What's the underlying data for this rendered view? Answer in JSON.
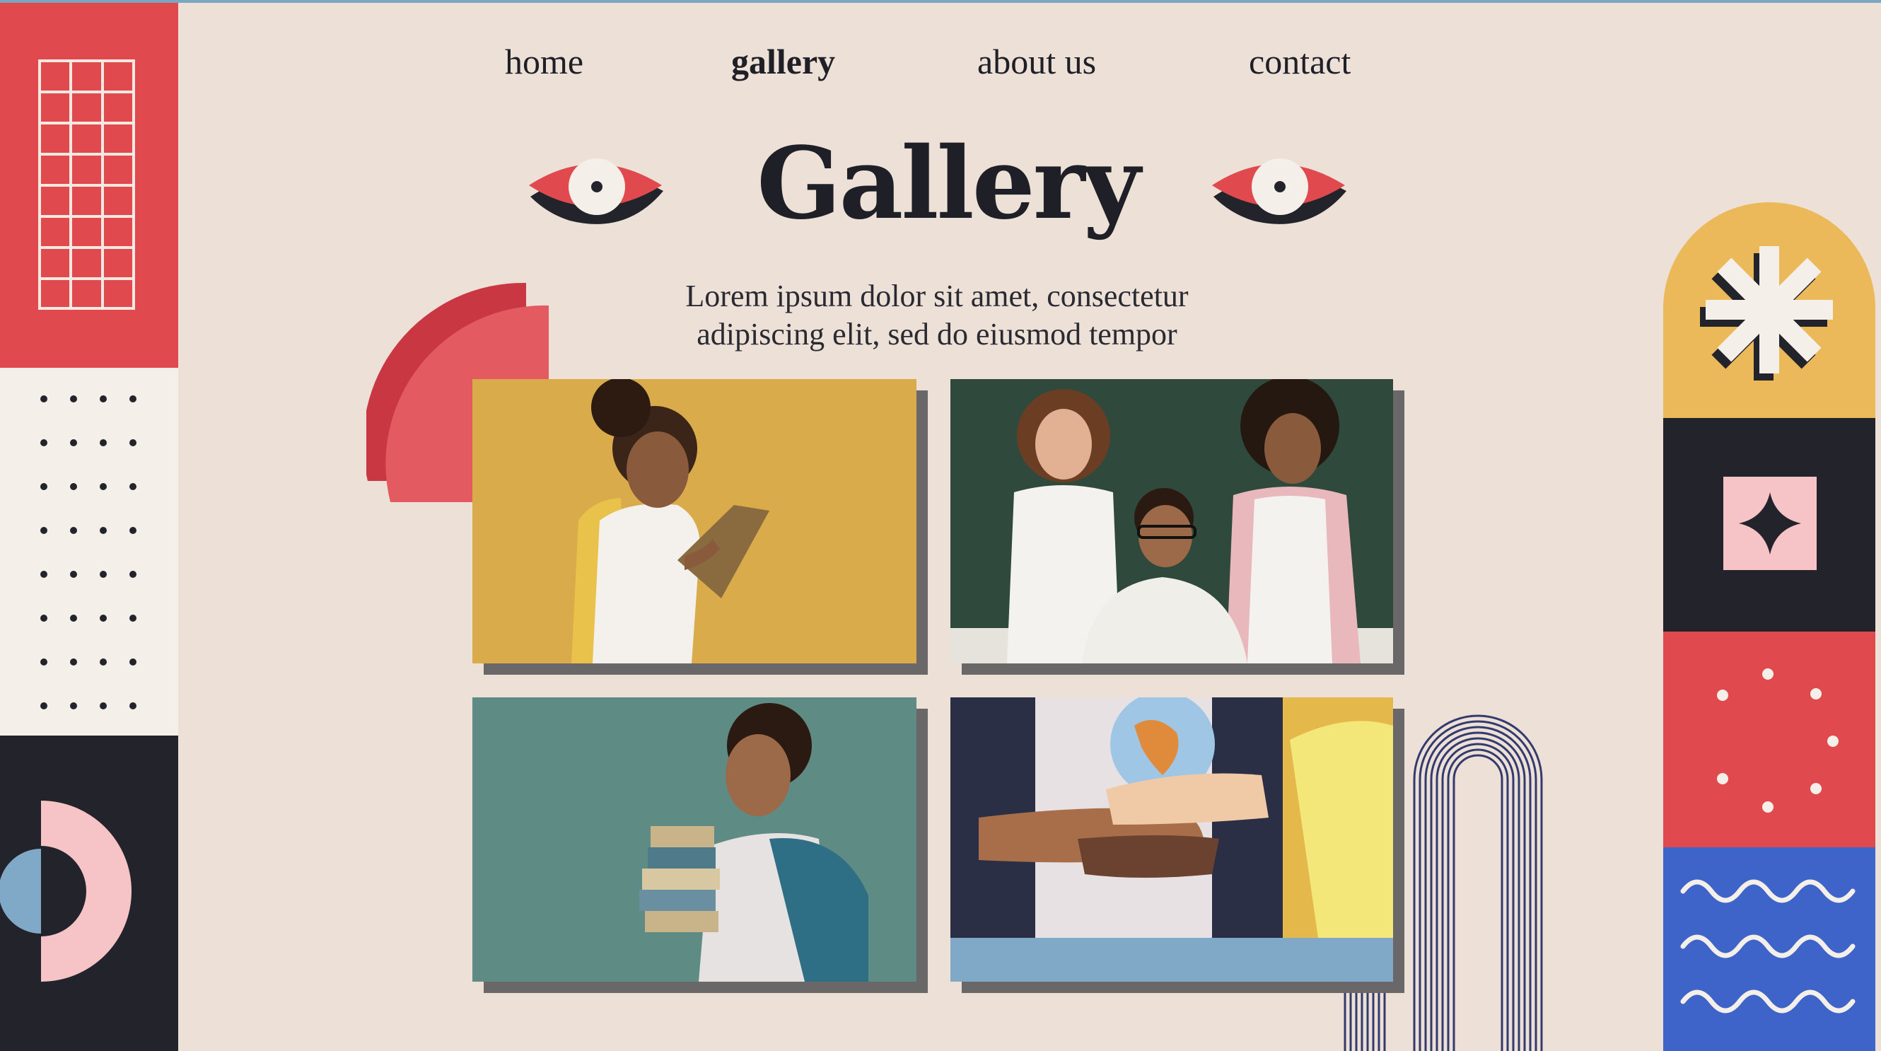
{
  "nav": {
    "items": [
      {
        "label": "home",
        "active": false
      },
      {
        "label": "gallery",
        "active": true
      },
      {
        "label": "about us",
        "active": false
      },
      {
        "label": "contact",
        "active": false
      }
    ]
  },
  "hero": {
    "title": "Gallery",
    "subtitle_line1": "Lorem ipsum dolor sit amet, consectetur",
    "subtitle_line2": "adipiscing elit, sed do eiusmod tempor"
  },
  "gallery": {
    "photos": [
      {
        "name": "girl-with-tablet",
        "bg": "#d9ab4a"
      },
      {
        "name": "three-kids-classroom",
        "bg": "#2f4a3c"
      },
      {
        "name": "boy-with-books",
        "bg": "#5e8c84"
      },
      {
        "name": "hands-holding-globe",
        "bg": "#e4b84b"
      }
    ]
  },
  "colors": {
    "background": "#ede0d7",
    "red": "#e04a4e",
    "dark": "#22232b",
    "yellow": "#ecb95a",
    "blue": "#3e63c9",
    "pink": "#f6c3c6",
    "light_blue": "#7fa9c6"
  },
  "icons": [
    "eye-icon",
    "asterisk-icon",
    "four-point-star-icon",
    "grid-icon"
  ]
}
